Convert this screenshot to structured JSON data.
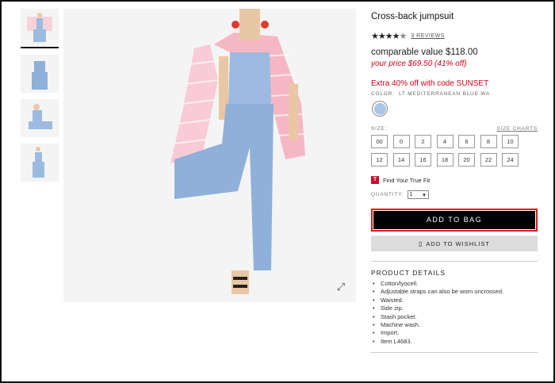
{
  "product": {
    "title": "Cross-back jumpsuit",
    "rating": 4.5,
    "reviews_link": "3 REVIEWS",
    "comparable_price": "comparable value $118.00",
    "sale_price": "your price $69.50 (41% off)",
    "promo": "Extra 40% off with code SUNSET",
    "color_label": "COLOR:",
    "color_name": "LT MEDITERRANEAN BLUE WA",
    "swatch_color": "#a9c4e4"
  },
  "sizes": {
    "label": "SIZE:",
    "chart_link": "SIZE CHARTS",
    "values": [
      "00",
      "0",
      "2",
      "4",
      "6",
      "8",
      "10",
      "12",
      "14",
      "16",
      "18",
      "20",
      "22",
      "24"
    ]
  },
  "truefit": {
    "logo": "T",
    "label": "Find Your True Fit"
  },
  "quantity": {
    "label": "QUANTITY:",
    "value": "1",
    "arrow": "▾"
  },
  "buttons": {
    "add_to_bag": "ADD TO BAG",
    "add_to_wishlist": "ADD TO WISHLIST",
    "wishlist_icon": "bookmark-icon",
    "expand_icon": "expand-icon",
    "expand_glyph": "⤢"
  },
  "details": {
    "title": "PRODUCT DETAILS",
    "items": [
      "Cotton/lyocell.",
      "Adjustable straps can also be worn uncrossed.",
      "Waisted.",
      "Side zip.",
      "Stash pocket.",
      "Machine wash.",
      "Import.",
      "Item L4683."
    ]
  },
  "colors": {
    "accent_red": "#d0021b",
    "button_black": "#000000",
    "highlight_red": "#ee1111"
  }
}
